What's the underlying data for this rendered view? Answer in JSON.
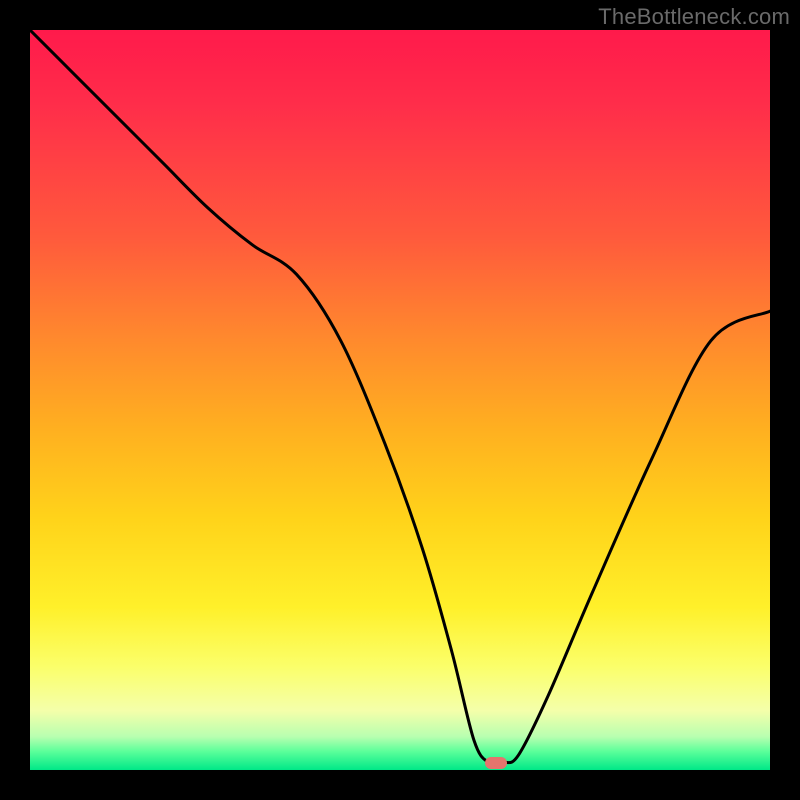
{
  "watermark": "TheBottleneck.com",
  "colors": {
    "frame_bg": "#000000",
    "curve": "#000000",
    "marker": "#e4746d",
    "gradient_top": "#ff1a4b",
    "gradient_bottom": "#00e888"
  },
  "chart_data": {
    "type": "line",
    "title": "",
    "xlabel": "",
    "ylabel": "",
    "xlim": [
      0,
      100
    ],
    "ylim": [
      0,
      100
    ],
    "note": "Unlabeled bottleneck curve on a heat gradient background. x and y are normalized 0–100. y≈0 is at the bottom (green), y≈100 at top (red). The curve dips to a minimum (bottleneck) near x≈63 where a marker is drawn.",
    "series": [
      {
        "name": "bottleneck-curve",
        "x": [
          0,
          6,
          12,
          18,
          24,
          30,
          36,
          42,
          48,
          53,
          57,
          60,
          62,
          64,
          66,
          70,
          76,
          84,
          92,
          100
        ],
        "y": [
          100,
          94,
          88,
          82,
          76,
          71,
          67,
          58,
          44,
          30,
          16,
          4,
          1,
          1,
          2,
          10,
          24,
          42,
          58,
          62
        ]
      }
    ],
    "marker": {
      "x": 63,
      "y": 1
    }
  }
}
